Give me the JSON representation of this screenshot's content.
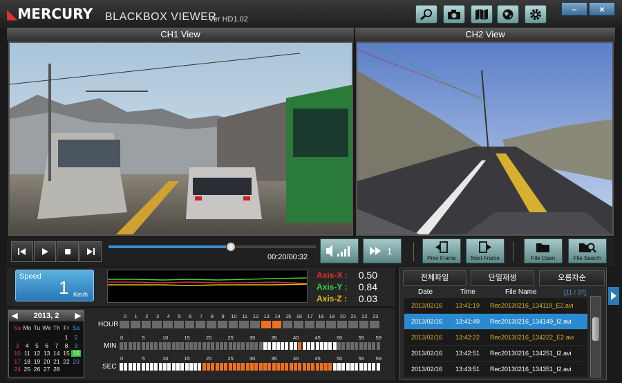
{
  "app": {
    "brand": "MERCURY",
    "name": "BLACKBOX VIEWER",
    "version": "Ver HD1.02"
  },
  "toolbar": {
    "icons": [
      "zoom-icon",
      "camera-icon",
      "map-icon",
      "globe-icon",
      "gear-icon"
    ],
    "minimize": "–",
    "close": "×"
  },
  "views": {
    "ch1": "CH1 View",
    "ch2": "CH2 View",
    "ch1_stamp": "…………………………"
  },
  "playback": {
    "time": "00:20/00:32",
    "progress": 0.59,
    "speed_multiplier": "1",
    "prev_frame": "Prev Frame",
    "next_frame": "Next Frame",
    "file_open": "File Open",
    "file_search": "File Search"
  },
  "sensor": {
    "speed_label": "Speed",
    "speed_value": "1",
    "speed_unit": "Km/h",
    "axis_x_label": "Axis-X :",
    "axis_x_value": "0.50",
    "axis_y_label": "Axis-Y :",
    "axis_y_value": "0.84",
    "axis_z_label": "Axis-Z :",
    "axis_z_value": "0.03",
    "colors": {
      "x": "#e03030",
      "y": "#40d040",
      "z": "#e0c020"
    }
  },
  "calendar": {
    "month": "2013, 2",
    "weekdays": [
      "Su",
      "Mo",
      "Tu",
      "We",
      "Th",
      "Fr",
      "Sa"
    ],
    "weeks": [
      [
        "",
        "",
        "",
        "",
        "",
        "1",
        "2"
      ],
      [
        "3",
        "4",
        "5",
        "6",
        "7",
        "8",
        "9"
      ],
      [
        "10",
        "11",
        "12",
        "13",
        "14",
        "15",
        "16"
      ],
      [
        "17",
        "18",
        "19",
        "20",
        "21",
        "22",
        "23"
      ],
      [
        "24",
        "25",
        "26",
        "27",
        "28",
        "",
        ""
      ]
    ]
  },
  "timeline": {
    "hour_label": "HOUR",
    "min_label": "MIN",
    "sec_label": "SEC",
    "hour_ticks": [
      "0",
      "1",
      "2",
      "3",
      "4",
      "5",
      "6",
      "7",
      "8",
      "9",
      "10",
      "11",
      "12",
      "13",
      "14",
      "15",
      "16",
      "17",
      "18",
      "19",
      "20",
      "21",
      "22",
      "23"
    ],
    "min_ticks": [
      "0",
      "5",
      "10",
      "15",
      "20",
      "25",
      "30",
      "35",
      "40",
      "45",
      "50",
      "55",
      "59"
    ],
    "sec_ticks": [
      "0",
      "5",
      "10",
      "15",
      "20",
      "25",
      "30",
      "35",
      "40",
      "45",
      "50",
      "55",
      "59"
    ],
    "hour_active": [
      13,
      14
    ]
  },
  "filelist": {
    "tabs": [
      "전체파일",
      "단일재생",
      "오름차순"
    ],
    "headers": {
      "date": "Date",
      "time": "Time",
      "name": "File Name",
      "count": "[11 / 37]"
    },
    "rows": [
      {
        "date": "2013/02/16",
        "time": "13:41:19",
        "name": "Rec20130216_134119_E2.avi",
        "style": "event"
      },
      {
        "date": "2013/02/16",
        "time": "13:41:49",
        "name": "Rec20130216_134149_I2.avi",
        "style": "selected"
      },
      {
        "date": "2013/02/16",
        "time": "13:42:22",
        "name": "Rec20130216_134222_E2.avi",
        "style": "event"
      },
      {
        "date": "2013/02/16",
        "time": "13:42:51",
        "name": "Rec20130216_134251_I2.avi",
        "style": "normal"
      },
      {
        "date": "2013/02/16",
        "time": "13:43:51",
        "name": "Rec20130216_134351_I2.avi",
        "style": "normal"
      }
    ]
  }
}
